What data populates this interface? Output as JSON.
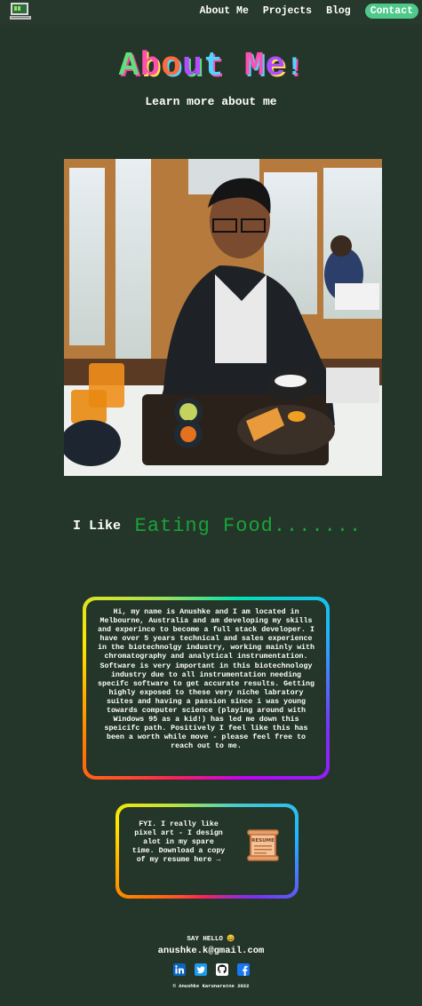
{
  "nav": {
    "links": [
      "About Me",
      "Projects",
      "Blog"
    ],
    "contact": "Contact",
    "logo_icon": "pixel-computer-icon"
  },
  "hero": {
    "title_letters": [
      "A",
      "b",
      "o",
      "u",
      "t",
      " ",
      "M",
      "e",
      "!"
    ],
    "subtitle": "Learn more about me"
  },
  "like": {
    "label": "I Like",
    "value": "Eating Food......."
  },
  "bio": {
    "text": "Hi, my name is Anushke and I am located in Melbourne, Australia and am developing my skills and experince to become a full stack developer. I have over 5 years technical and sales experience in the biotechnolgy industry, working mainly with chromatography and analytical instrumentation. Software is very important in this biotechnology industry due to all instrumentation needing specifc software to get accurate results. Getting highly exposed to these very niche labratory suites and having a passion since i was young towards computer science (playing around with Windows 95 as a kid!) has led me down this speicifc path. Positively I feel like this has been a worth while move - please feel free to reach out to me."
  },
  "resume": {
    "text": "FYI. I really like pixel art - I design alot in my spare time. Download a copy of my resume here →",
    "icon_label": "RESUME",
    "icon": "resume-scroll-icon"
  },
  "footer": {
    "say_hello": "SAY HELLO 😀",
    "email": "anushke.k@gmail.com",
    "socials": [
      "linkedin-icon",
      "twitter-icon",
      "github-icon",
      "facebook-icon"
    ],
    "copyright": "© Anushke Karunaratne 2022"
  },
  "colors": {
    "background": "#243529",
    "accent": "#4ec98a",
    "like_value": "#1aa33a"
  }
}
